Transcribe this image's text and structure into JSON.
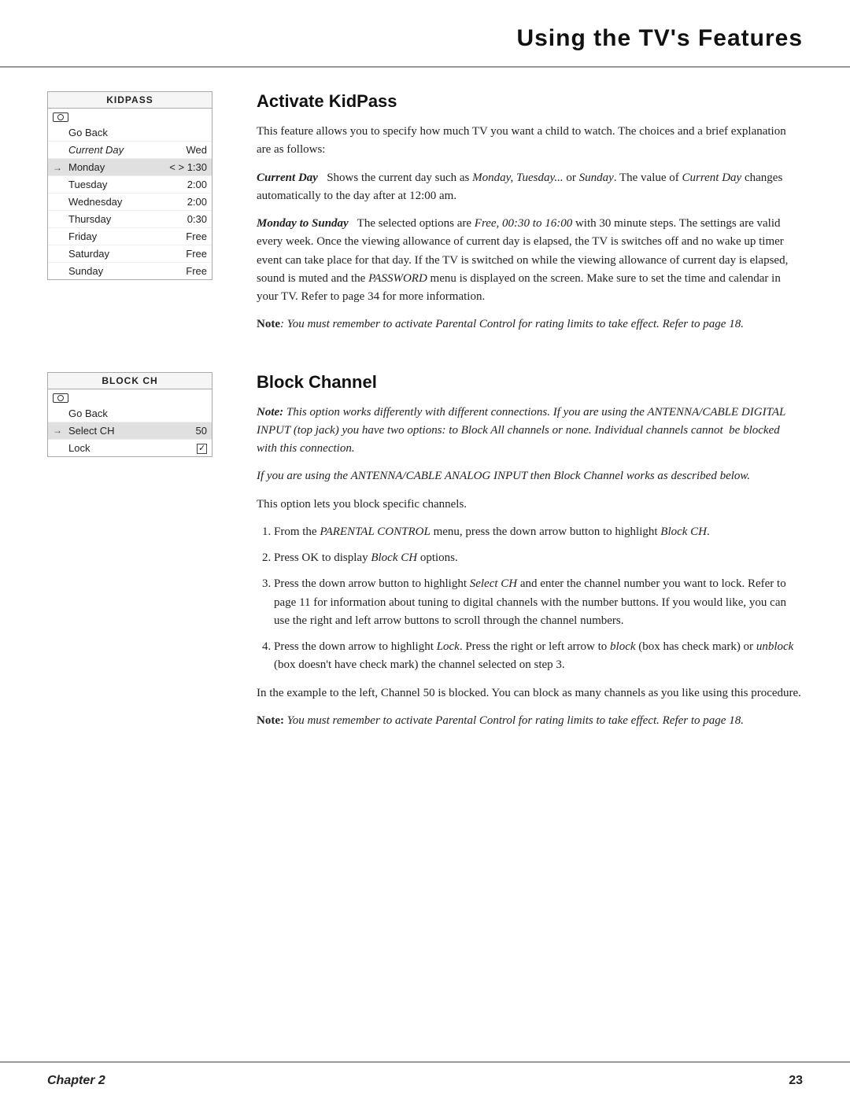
{
  "header": {
    "title": "Using the TV's Features"
  },
  "kidpass_section": {
    "title": "Activate KidPass",
    "menu": {
      "title": "KIDPASS",
      "rows": [
        {
          "arrow": "",
          "label": "Go Back",
          "value": ""
        },
        {
          "arrow": "",
          "label": "Current Day",
          "value": "Wed",
          "highlighted": false,
          "italic": true
        },
        {
          "arrow": "→",
          "label": "Monday",
          "value": "< > 1:30",
          "highlighted": true
        },
        {
          "arrow": "",
          "label": "Tuesday",
          "value": "2:00"
        },
        {
          "arrow": "",
          "label": "Wednesday",
          "value": "2:00"
        },
        {
          "arrow": "",
          "label": "Thursday",
          "value": "0:30"
        },
        {
          "arrow": "",
          "label": "Friday",
          "value": "Free"
        },
        {
          "arrow": "",
          "label": "Saturday",
          "value": "Free"
        },
        {
          "arrow": "",
          "label": "Sunday",
          "value": "Free"
        }
      ]
    },
    "paragraphs": [
      {
        "type": "intro",
        "text": "This feature allows you to specify how much TV you want a child to watch. The choices and a brief explanation are as follows:"
      },
      {
        "type": "term",
        "term": "Current Day",
        "bold_italic": true,
        "body": "Shows the current day such as Monday, Tuesday... or Sunday. The value of Current Day changes automatically to the day after at 12:00 am."
      },
      {
        "type": "term",
        "term": "Monday to Sunday",
        "bold_italic": true,
        "body": "The selected options are Free, 00:30 to 16:00 with 30 minute steps. The settings are valid every week. Once the viewing allowance of current day is elapsed, the TV is switches off and no wake up timer event can take place for that day. If the TV is switched on while the viewing allowance of current day is elapsed, sound is muted and the PASSWORD menu is displayed on the screen. Make sure to set the time and calendar in your TV. Refer to page 34 for more information."
      },
      {
        "type": "note",
        "text": "Note: You must remember to activate Parental Control for rating limits to take effect. Refer to page 18."
      }
    ]
  },
  "blockchannel_section": {
    "title": "Block Channel",
    "menu": {
      "title": "BLOCK CH",
      "rows": [
        {
          "arrow": "",
          "label": "Go Back",
          "value": ""
        },
        {
          "arrow": "→",
          "label": "Select CH",
          "value": "50",
          "highlighted": true
        },
        {
          "arrow": "",
          "label": "Lock",
          "value": "checkbox",
          "checked": true
        }
      ]
    },
    "paragraphs": [
      {
        "type": "note_italic",
        "text": "Note: This option works differently with different connections. If you are using the ANTENNA/CABLE DIGITAL INPUT (top jack) you have two options: to Block All channels or none. Individual channels cannot be blocked with this connection."
      },
      {
        "type": "italic_para",
        "text": "If you are using the ANTENNA/CABLE ANALOG INPUT then Block Channel works as described below."
      },
      {
        "type": "plain",
        "text": "This option lets you block specific channels."
      },
      {
        "type": "list",
        "items": [
          "From the PARENTAL CONTROL menu, press the down arrow button to highlight Block CH.",
          "Press OK to display Block CH options.",
          "Press the down arrow button to highlight Select CH and enter the channel number you want to lock. Refer to page 11 for information about tuning to digital channels with the number buttons. If you would like, you can use the right and left arrow buttons to scroll through the channel numbers.",
          "Press the down arrow to highlight Lock. Press the right or left arrow to block (box has check mark) or unblock (box doesn't have check mark) the channel selected on step 3."
        ]
      },
      {
        "type": "plain",
        "text": "In the example to the left, Channel 50 is blocked. You can block as many channels as you like using this procedure."
      },
      {
        "type": "note",
        "text": "Note: You must remember to activate Parental Control for rating limits to take effect. Refer to page 18."
      }
    ]
  },
  "footer": {
    "left": "Chapter 2",
    "right": "23"
  }
}
